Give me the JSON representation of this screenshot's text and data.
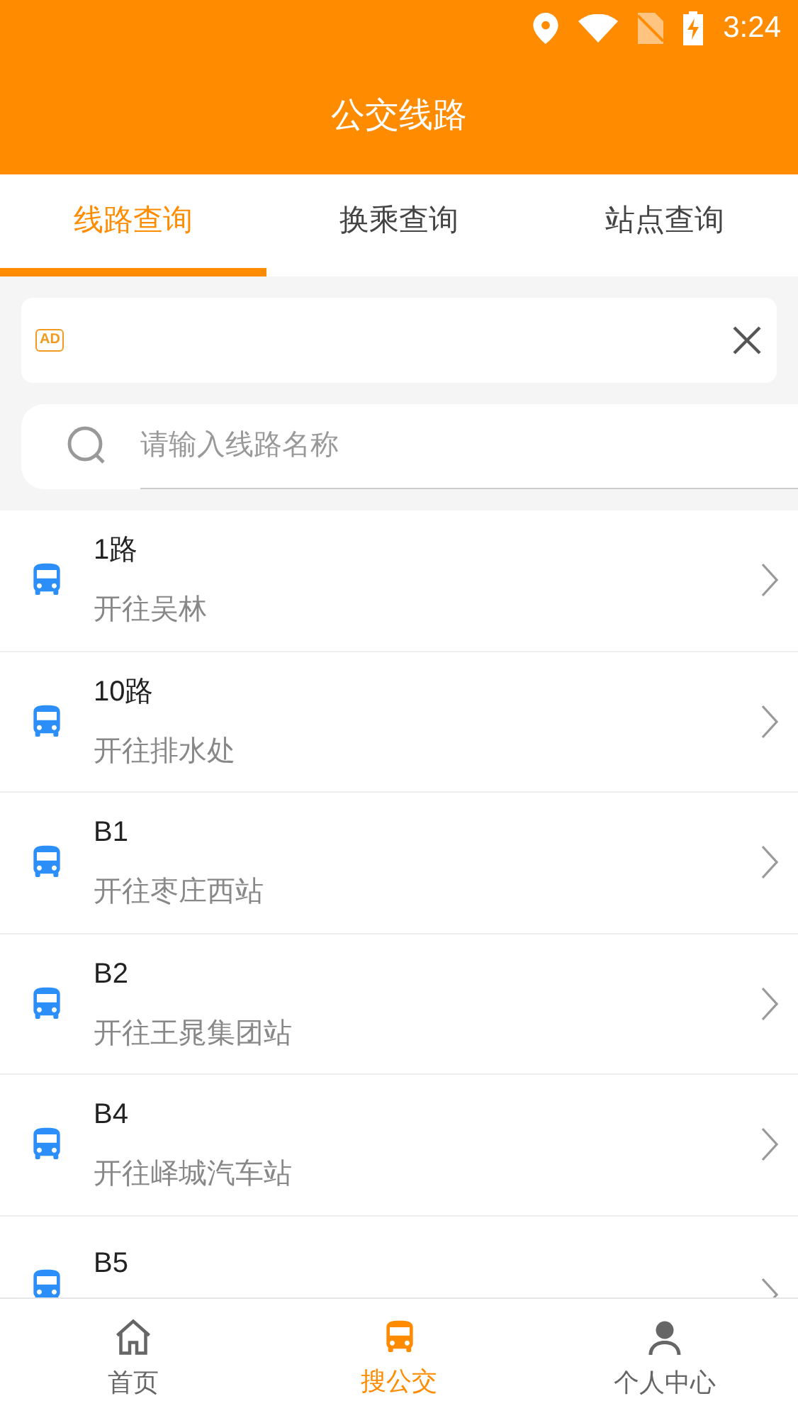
{
  "status_bar": {
    "time": "3:24"
  },
  "header": {
    "title": "公交线路"
  },
  "tabs": [
    {
      "label": "线路查询",
      "selected": true
    },
    {
      "label": "换乘查询",
      "selected": false
    },
    {
      "label": "站点查询",
      "selected": false
    }
  ],
  "ad": {
    "badge": "AD"
  },
  "search": {
    "placeholder": "请输入线路名称"
  },
  "routes": [
    {
      "name": "1路",
      "direction": "开往吴林"
    },
    {
      "name": "10路",
      "direction": "开往排水处"
    },
    {
      "name": "B1",
      "direction": "开往枣庄西站"
    },
    {
      "name": "B2",
      "direction": "开往王晁集团站"
    },
    {
      "name": "B4",
      "direction": "开往峄城汽车站"
    },
    {
      "name": "B5"
    }
  ],
  "bottom_nav": [
    {
      "kind": "home",
      "label": "首页",
      "selected": false
    },
    {
      "kind": "bus",
      "label": "搜公交",
      "selected": true
    },
    {
      "kind": "person",
      "label": "个人中心",
      "selected": false
    }
  ]
}
